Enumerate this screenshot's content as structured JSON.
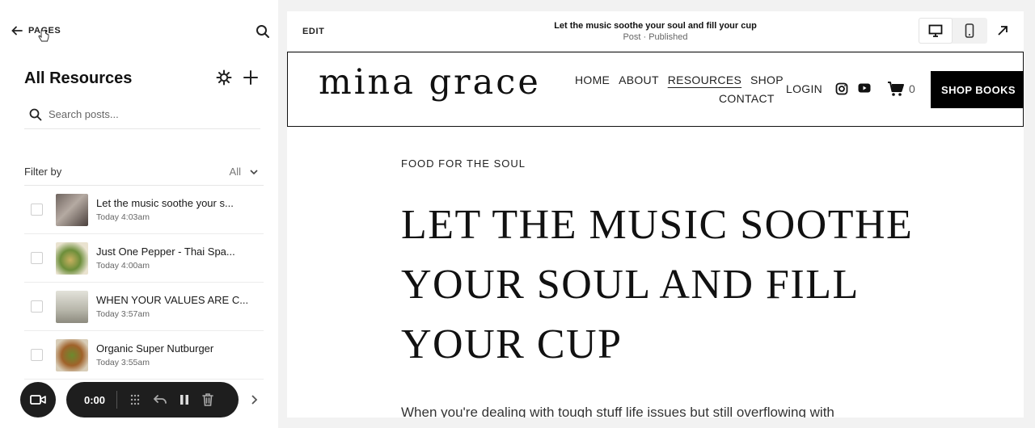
{
  "sidebar": {
    "back_label": "PAGES",
    "heading": "All Resources",
    "search_placeholder": "Search posts...",
    "filter_label": "Filter by",
    "filter_value": "All",
    "posts": [
      {
        "title": "Let the music soothe your s...",
        "time": "Today 4:03am",
        "thumb_color": "#8d7f78"
      },
      {
        "title": "Just One Pepper - Thai Spa...",
        "time": "Today 4:00am",
        "thumb_color": "#7f9a5a"
      },
      {
        "title": "WHEN YOUR VALUES ARE C...",
        "time": "Today 3:57am",
        "thumb_color": "#c9c8bd"
      },
      {
        "title": "Organic Super Nutburger",
        "time": "Today 3:55am",
        "thumb_color": "#8a6a3a"
      }
    ]
  },
  "recorder": {
    "timer": "0:00"
  },
  "preview": {
    "edit_label": "EDIT",
    "doc_title": "Let the music soothe your soul and fill your cup",
    "doc_status": "Post · Published",
    "site": {
      "logo": "mina grace",
      "nav_row1": [
        "HOME",
        "ABOUT",
        "RESOURCES",
        "SHOP"
      ],
      "nav_row2": [
        "CONTACT"
      ],
      "login": "LOGIN",
      "cart_count": "0",
      "cta": "SHOP BOOKS"
    },
    "category": "FOOD FOR THE SOUL",
    "post_title": "LET THE MUSIC SOOTHE YOUR SOUL AND FILL YOUR CUP",
    "excerpt": "When you're dealing with tough stuff life issues but still overflowing with"
  }
}
